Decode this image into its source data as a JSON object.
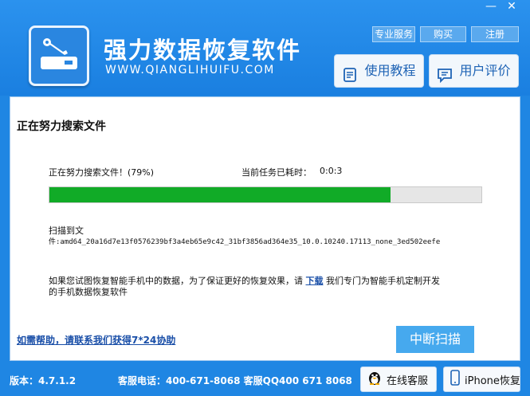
{
  "window": {
    "minimize_label": "—",
    "close_label": "✕"
  },
  "header": {
    "app_title": "强力数据恢复软件",
    "app_url": "WWW.QIANGLIHUIFU.COM",
    "links": [
      "专业服务",
      "购买",
      "注册"
    ],
    "tutorial_label": "使用教程",
    "review_label": "用户评价"
  },
  "scan": {
    "title": "正在努力搜索文件",
    "status_text": "正在努力搜索文件！(79%)",
    "progress_percent": 79,
    "elapsed_label": "当前任务已耗时：",
    "elapsed_value": "0:0:3",
    "scanning_label": "扫描到文",
    "scanning_path": "件:amd64_20a16d7e13f0576239bf3a4eb65e9c42_31bf3856ad364e35_10.0.10240.17113_none_3ed502eefe",
    "note_pre": "如果您试图恢复智能手机中的数据，为了保证更好的恢复效果，请",
    "note_link": "下载",
    "note_post": "我们专门为智能手机定制开发",
    "note_line2": "的手机数据恢复软件",
    "help_link": "如需帮助，请联系我们获得7*24协助",
    "stop_label": "中断扫描"
  },
  "footer": {
    "version": "版本：4.7.1.2",
    "phone": "客服电话：400-671-8068 客服QQ400 671 8068",
    "online_service_label": "在线客服",
    "iphone_label": "iPhone恢复"
  },
  "colors": {
    "brand_blue": "#1f86e3",
    "progress_green": "#11ab27",
    "stop_button": "#46a9ee"
  }
}
